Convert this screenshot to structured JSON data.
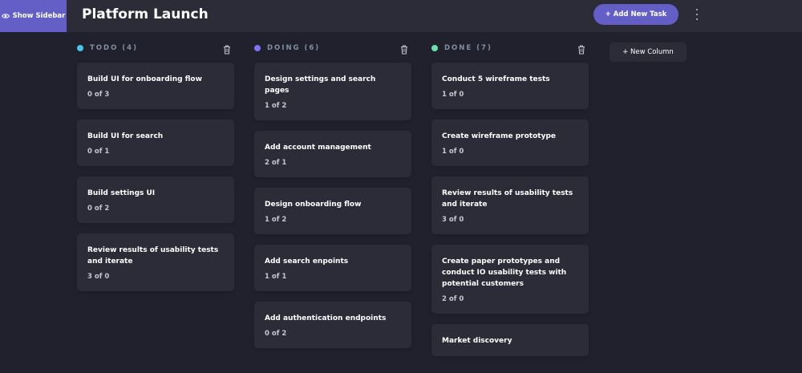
{
  "header": {
    "show_sidebar_label": "Show Sidebar",
    "board_title": "Platform Launch",
    "add_task_label": "+ Add New Task"
  },
  "new_column_label": "+ New Column",
  "colors": {
    "accent": "#635fc7",
    "todo_dot": "#49c4e5",
    "doing_dot": "#8471f2",
    "done_dot": "#67e2ae"
  },
  "columns": [
    {
      "title": "TODO (4)",
      "cards": [
        {
          "title": "Build UI for onboarding flow",
          "sub": "0 of 3"
        },
        {
          "title": "Build UI for search",
          "sub": "0 of 1"
        },
        {
          "title": "Build settings UI",
          "sub": "0 of 2"
        },
        {
          "title": "Review results of usability tests and iterate",
          "sub": "3 of 0"
        }
      ]
    },
    {
      "title": "DOING (6)",
      "cards": [
        {
          "title": "Design settings and search pages",
          "sub": "1 of 2"
        },
        {
          "title": "Add account management",
          "sub": "2 of 1"
        },
        {
          "title": "Design onboarding flow",
          "sub": "1 of 2"
        },
        {
          "title": "Add search enpoints",
          "sub": "1 of 1"
        },
        {
          "title": "Add authentication endpoints",
          "sub": "0 of 2"
        }
      ]
    },
    {
      "title": "DONE (7)",
      "cards": [
        {
          "title": "Conduct 5 wireframe tests",
          "sub": "1 of 0"
        },
        {
          "title": "Create wireframe prototype",
          "sub": "1 of 0"
        },
        {
          "title": "Review results of usability tests and iterate",
          "sub": "3 of 0"
        },
        {
          "title": "Create paper prototypes and conduct IO usability tests with potential customers",
          "sub": "2 of 0"
        },
        {
          "title": "Market discovery",
          "sub": ""
        }
      ]
    }
  ]
}
